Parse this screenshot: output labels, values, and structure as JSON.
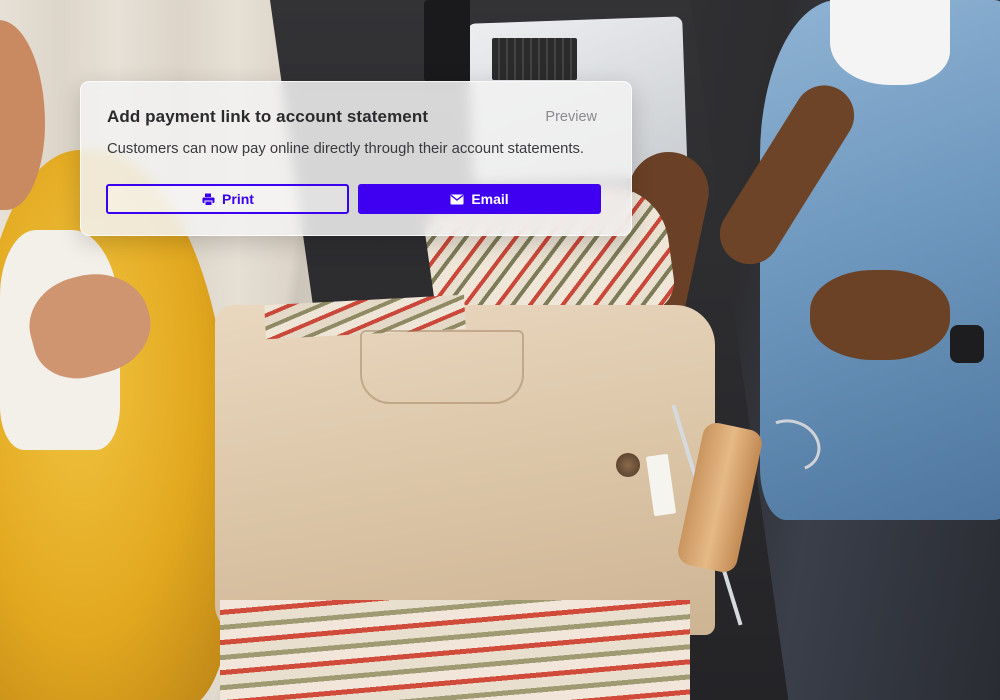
{
  "card": {
    "title": "Add payment link to account statement",
    "preview_label": "Preview",
    "body": "Customers can now pay online directly through their account statements.",
    "print_button": {
      "label": "Print",
      "icon": "printer-icon"
    },
    "email_button": {
      "label": "Email",
      "icon": "envelope-icon"
    }
  },
  "colors": {
    "accent": "#3f00f2",
    "card_background": "#f2f2f2",
    "title_text": "#2b2b2e",
    "muted_text": "#8a8a8e"
  }
}
